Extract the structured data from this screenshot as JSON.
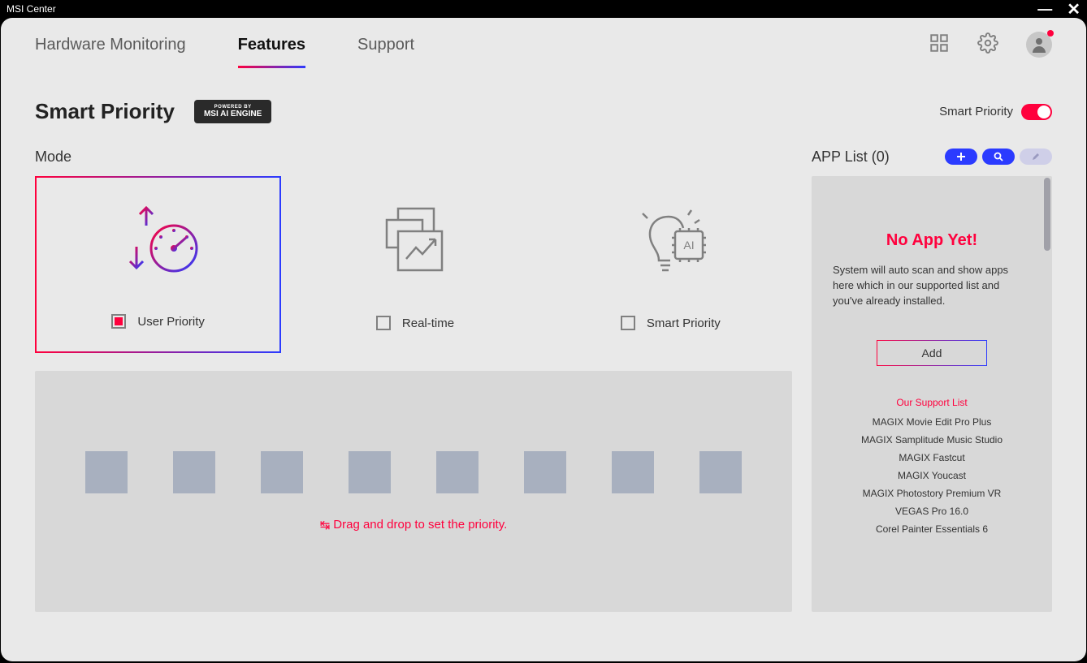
{
  "window": {
    "title": "MSI Center"
  },
  "nav": {
    "tabs": [
      {
        "label": "Hardware Monitoring",
        "active": false
      },
      {
        "label": "Features",
        "active": true
      },
      {
        "label": "Support",
        "active": false
      }
    ]
  },
  "page": {
    "title": "Smart Priority",
    "ai_badge_small": "POWERED BY",
    "ai_badge": "MSI AI ENGINE",
    "toggle_label": "Smart Priority",
    "toggle_on": true
  },
  "mode": {
    "heading": "Mode",
    "options": [
      {
        "label": "User Priority",
        "checked": true
      },
      {
        "label": "Real-time",
        "checked": false
      },
      {
        "label": "Smart Priority",
        "checked": false
      }
    ]
  },
  "dropzone": {
    "hint": "Drag and drop to set the priority.",
    "slot_count": 8
  },
  "applist": {
    "heading_prefix": "APP List",
    "count": 0,
    "noapp_title": "No App Yet!",
    "noapp_desc": "System will auto scan and show apps here which in our supported list and you've already installed.",
    "add_label": "Add",
    "support_title": "Our Support List",
    "support_items": [
      "MAGIX Movie Edit Pro Plus",
      "MAGIX Samplitude Music Studio",
      "MAGIX Fastcut",
      "MAGIX Youcast",
      "MAGIX Photostory Premium VR",
      "VEGAS Pro 16.0",
      "Corel Painter Essentials 6"
    ]
  },
  "colors": {
    "accent_red": "#ff003d",
    "accent_blue": "#2b3bff"
  }
}
